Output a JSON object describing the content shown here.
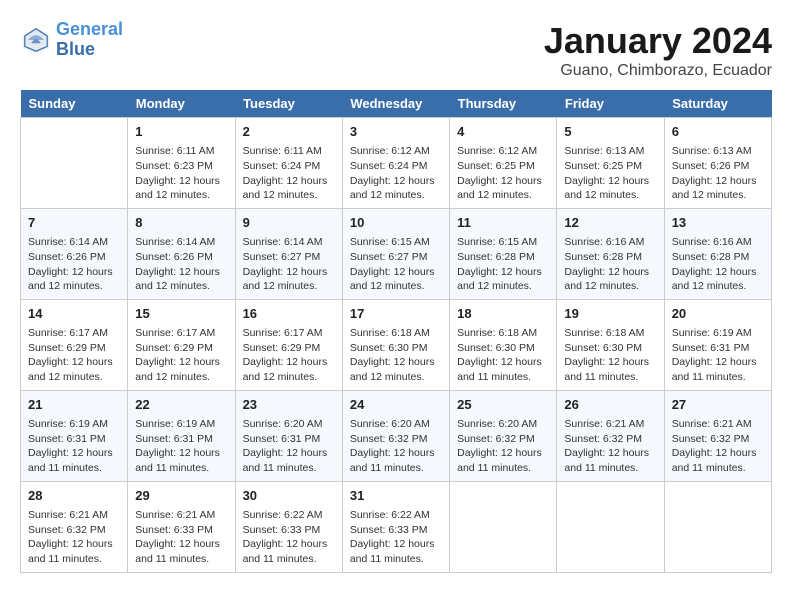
{
  "logo": {
    "line1": "General",
    "line2": "Blue"
  },
  "title": "January 2024",
  "location": "Guano, Chimborazo, Ecuador",
  "headers": [
    "Sunday",
    "Monday",
    "Tuesday",
    "Wednesday",
    "Thursday",
    "Friday",
    "Saturday"
  ],
  "weeks": [
    [
      {
        "day": "",
        "sunrise": "",
        "sunset": "",
        "daylight": ""
      },
      {
        "day": "1",
        "sunrise": "Sunrise: 6:11 AM",
        "sunset": "Sunset: 6:23 PM",
        "daylight": "Daylight: 12 hours and 12 minutes."
      },
      {
        "day": "2",
        "sunrise": "Sunrise: 6:11 AM",
        "sunset": "Sunset: 6:24 PM",
        "daylight": "Daylight: 12 hours and 12 minutes."
      },
      {
        "day": "3",
        "sunrise": "Sunrise: 6:12 AM",
        "sunset": "Sunset: 6:24 PM",
        "daylight": "Daylight: 12 hours and 12 minutes."
      },
      {
        "day": "4",
        "sunrise": "Sunrise: 6:12 AM",
        "sunset": "Sunset: 6:25 PM",
        "daylight": "Daylight: 12 hours and 12 minutes."
      },
      {
        "day": "5",
        "sunrise": "Sunrise: 6:13 AM",
        "sunset": "Sunset: 6:25 PM",
        "daylight": "Daylight: 12 hours and 12 minutes."
      },
      {
        "day": "6",
        "sunrise": "Sunrise: 6:13 AM",
        "sunset": "Sunset: 6:26 PM",
        "daylight": "Daylight: 12 hours and 12 minutes."
      }
    ],
    [
      {
        "day": "7",
        "sunrise": "Sunrise: 6:14 AM",
        "sunset": "Sunset: 6:26 PM",
        "daylight": "Daylight: 12 hours and 12 minutes."
      },
      {
        "day": "8",
        "sunrise": "Sunrise: 6:14 AM",
        "sunset": "Sunset: 6:26 PM",
        "daylight": "Daylight: 12 hours and 12 minutes."
      },
      {
        "day": "9",
        "sunrise": "Sunrise: 6:14 AM",
        "sunset": "Sunset: 6:27 PM",
        "daylight": "Daylight: 12 hours and 12 minutes."
      },
      {
        "day": "10",
        "sunrise": "Sunrise: 6:15 AM",
        "sunset": "Sunset: 6:27 PM",
        "daylight": "Daylight: 12 hours and 12 minutes."
      },
      {
        "day": "11",
        "sunrise": "Sunrise: 6:15 AM",
        "sunset": "Sunset: 6:28 PM",
        "daylight": "Daylight: 12 hours and 12 minutes."
      },
      {
        "day": "12",
        "sunrise": "Sunrise: 6:16 AM",
        "sunset": "Sunset: 6:28 PM",
        "daylight": "Daylight: 12 hours and 12 minutes."
      },
      {
        "day": "13",
        "sunrise": "Sunrise: 6:16 AM",
        "sunset": "Sunset: 6:28 PM",
        "daylight": "Daylight: 12 hours and 12 minutes."
      }
    ],
    [
      {
        "day": "14",
        "sunrise": "Sunrise: 6:17 AM",
        "sunset": "Sunset: 6:29 PM",
        "daylight": "Daylight: 12 hours and 12 minutes."
      },
      {
        "day": "15",
        "sunrise": "Sunrise: 6:17 AM",
        "sunset": "Sunset: 6:29 PM",
        "daylight": "Daylight: 12 hours and 12 minutes."
      },
      {
        "day": "16",
        "sunrise": "Sunrise: 6:17 AM",
        "sunset": "Sunset: 6:29 PM",
        "daylight": "Daylight: 12 hours and 12 minutes."
      },
      {
        "day": "17",
        "sunrise": "Sunrise: 6:18 AM",
        "sunset": "Sunset: 6:30 PM",
        "daylight": "Daylight: 12 hours and 12 minutes."
      },
      {
        "day": "18",
        "sunrise": "Sunrise: 6:18 AM",
        "sunset": "Sunset: 6:30 PM",
        "daylight": "Daylight: 12 hours and 11 minutes."
      },
      {
        "day": "19",
        "sunrise": "Sunrise: 6:18 AM",
        "sunset": "Sunset: 6:30 PM",
        "daylight": "Daylight: 12 hours and 11 minutes."
      },
      {
        "day": "20",
        "sunrise": "Sunrise: 6:19 AM",
        "sunset": "Sunset: 6:31 PM",
        "daylight": "Daylight: 12 hours and 11 minutes."
      }
    ],
    [
      {
        "day": "21",
        "sunrise": "Sunrise: 6:19 AM",
        "sunset": "Sunset: 6:31 PM",
        "daylight": "Daylight: 12 hours and 11 minutes."
      },
      {
        "day": "22",
        "sunrise": "Sunrise: 6:19 AM",
        "sunset": "Sunset: 6:31 PM",
        "daylight": "Daylight: 12 hours and 11 minutes."
      },
      {
        "day": "23",
        "sunrise": "Sunrise: 6:20 AM",
        "sunset": "Sunset: 6:31 PM",
        "daylight": "Daylight: 12 hours and 11 minutes."
      },
      {
        "day": "24",
        "sunrise": "Sunrise: 6:20 AM",
        "sunset": "Sunset: 6:32 PM",
        "daylight": "Daylight: 12 hours and 11 minutes."
      },
      {
        "day": "25",
        "sunrise": "Sunrise: 6:20 AM",
        "sunset": "Sunset: 6:32 PM",
        "daylight": "Daylight: 12 hours and 11 minutes."
      },
      {
        "day": "26",
        "sunrise": "Sunrise: 6:21 AM",
        "sunset": "Sunset: 6:32 PM",
        "daylight": "Daylight: 12 hours and 11 minutes."
      },
      {
        "day": "27",
        "sunrise": "Sunrise: 6:21 AM",
        "sunset": "Sunset: 6:32 PM",
        "daylight": "Daylight: 12 hours and 11 minutes."
      }
    ],
    [
      {
        "day": "28",
        "sunrise": "Sunrise: 6:21 AM",
        "sunset": "Sunset: 6:32 PM",
        "daylight": "Daylight: 12 hours and 11 minutes."
      },
      {
        "day": "29",
        "sunrise": "Sunrise: 6:21 AM",
        "sunset": "Sunset: 6:33 PM",
        "daylight": "Daylight: 12 hours and 11 minutes."
      },
      {
        "day": "30",
        "sunrise": "Sunrise: 6:22 AM",
        "sunset": "Sunset: 6:33 PM",
        "daylight": "Daylight: 12 hours and 11 minutes."
      },
      {
        "day": "31",
        "sunrise": "Sunrise: 6:22 AM",
        "sunset": "Sunset: 6:33 PM",
        "daylight": "Daylight: 12 hours and 11 minutes."
      },
      {
        "day": "",
        "sunrise": "",
        "sunset": "",
        "daylight": ""
      },
      {
        "day": "",
        "sunrise": "",
        "sunset": "",
        "daylight": ""
      },
      {
        "day": "",
        "sunrise": "",
        "sunset": "",
        "daylight": ""
      }
    ]
  ]
}
